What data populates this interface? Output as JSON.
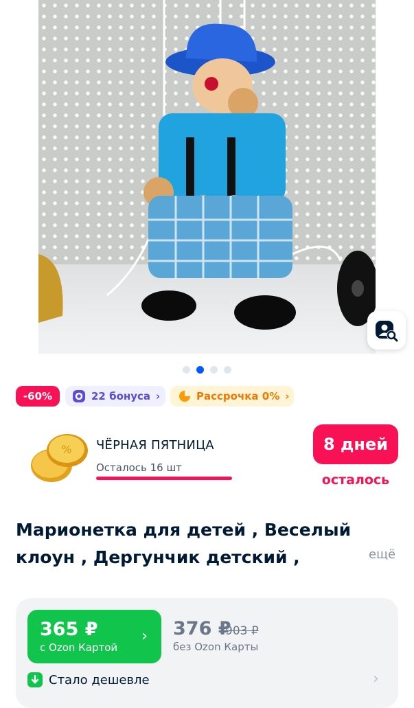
{
  "product": {
    "image_alt": "clown-marionette-photo",
    "title": "Марионетка для детей , Веселый клоун , Дергунчик детский , Детский театр",
    "more_label": "ещё"
  },
  "gallery": {
    "dots": 4,
    "active_index": 1
  },
  "badges": {
    "discount": "-60%",
    "bonus": "22 бонуса",
    "installment": "Рассрочка 0%"
  },
  "promo": {
    "title": "ЧЁРНАЯ ПЯТНИЦА",
    "remaining": "Осталось 16 шт",
    "days": "8 дней",
    "days_suffix": "осталось"
  },
  "price": {
    "card_price": "365 ₽",
    "card_label": "с Ozon Картой",
    "regular_price": "376 ₽",
    "old_price": "903 ₽",
    "regular_label": "без Ozon Карты",
    "cheaper_label": "Стало дешевле"
  },
  "colors": {
    "accent_pink": "#f91155",
    "ozon_green": "#10c44c",
    "ozon_blue": "#005bff"
  }
}
